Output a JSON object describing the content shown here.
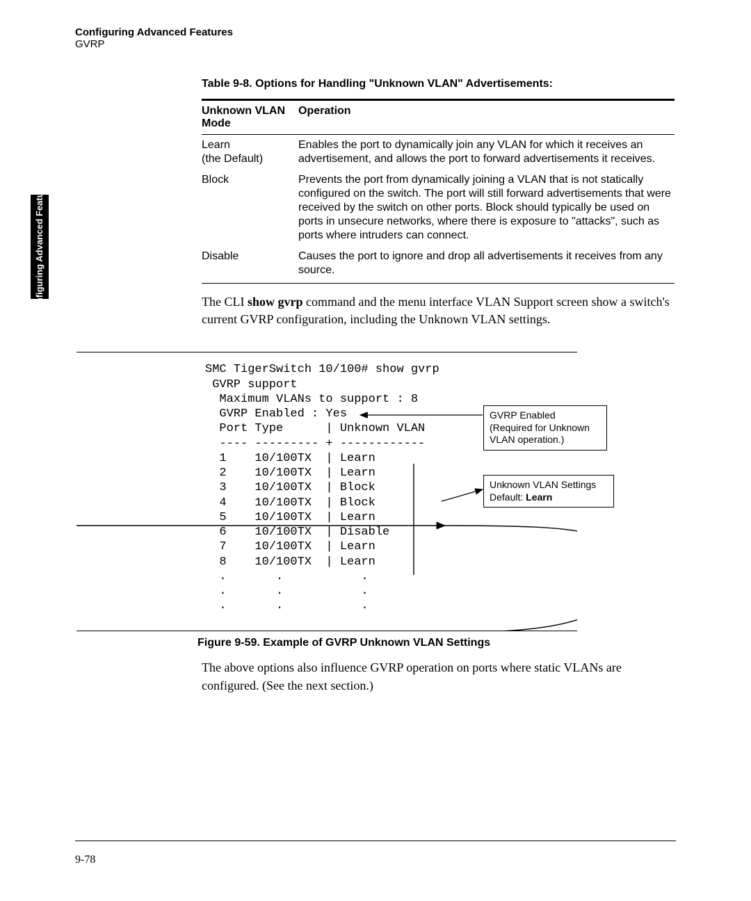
{
  "header": {
    "title": "Configuring Advanced Features",
    "subtitle": "GVRP"
  },
  "sideTab": "Configuring Advanced\nFeatures",
  "tableTitle": "Table 9-8. Options for Handling \"Unknown VLAN\" Advertisements:",
  "table": {
    "headers": {
      "col1": "Unknown VLAN Mode",
      "col2": "Operation"
    },
    "rows": [
      {
        "mode": "Learn\n(the Default)",
        "op": "Enables the port to dynamically join any VLAN for which it receives an advertisement, and allows the port to forward  advertisements it receives."
      },
      {
        "mode": "Block",
        "op": "Prevents the port from dynamically joining a VLAN that is not statically configured on the switch. The port will still forward advertisements that were received by the switch on other ports. Block should typically be used on ports in unsecure networks, where there is exposure to \"attacks\", such as ports where intruders can connect."
      },
      {
        "mode": "Disable",
        "op": "Causes the port to ignore and drop all advertisements it receives from any source."
      }
    ]
  },
  "para1": {
    "pre": "The CLI ",
    "cmd": "show gvrp",
    "post": " command and the menu interface VLAN Support screen show a switch's current GVRP configuration, including the Unknown VLAN settings."
  },
  "cli": "SMC TigerSwitch 10/100# show gvrp\n GVRP support\n  Maximum VLANs to support : 8\n  GVRP Enabled : Yes\n  Port Type      | Unknown VLAN\n  ---- --------- + ------------\n  1    10/100TX  | Learn\n  2    10/100TX  | Learn\n  3    10/100TX  | Block\n  4    10/100TX  | Block\n  5    10/100TX  | Learn\n  6    10/100TX  | Disable\n  7    10/100TX  | Learn\n  8    10/100TX  | Learn\n  .       .           .\n  .       .           .\n  .       .           .",
  "callout1": {
    "l1": "GVRP Enabled",
    "l2": "(Required for Unknown VLAN operation.)"
  },
  "callout2": {
    "l1": "Unknown VLAN Settings",
    "l2pre": "Default: ",
    "l2b": "Learn"
  },
  "figCaption": "Figure 9-59.  Example of GVRP Unknown VLAN Settings",
  "para2": "The above options also influence GVRP operation on ports where static VLANs are configured. (See the next section.)",
  "pageNum": "9-78"
}
